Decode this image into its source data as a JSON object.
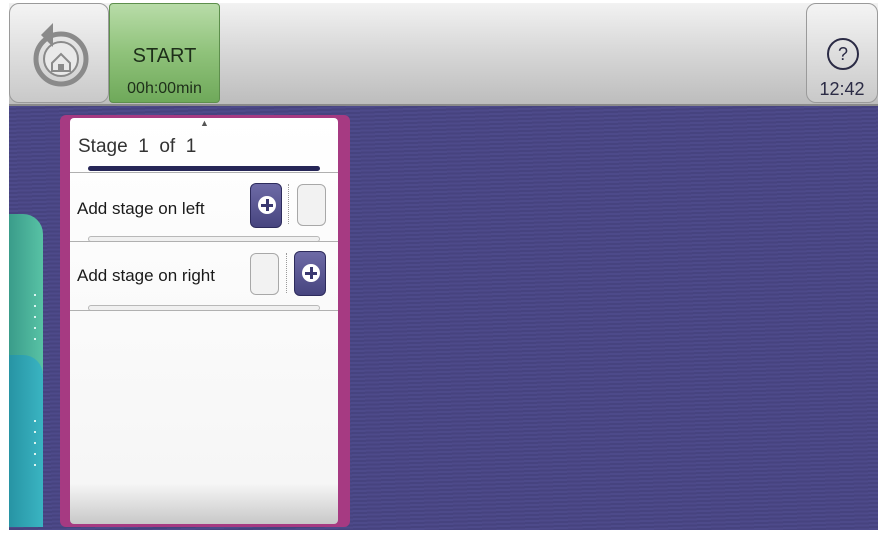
{
  "topbar": {
    "home_icon": "home-undo-icon",
    "start": {
      "label": "START",
      "time": "00h:00min"
    },
    "help": {
      "icon": "?",
      "clock": "12:42"
    }
  },
  "stage_panel": {
    "scroll_indicator": "▲",
    "stage_label": "Stage",
    "stage_current": "1",
    "stage_of": "of",
    "stage_total": "1",
    "rows": [
      {
        "label": "Add stage on left"
      },
      {
        "label": "Add stage on right"
      }
    ]
  },
  "colors": {
    "background": "#4d4a8a",
    "panel_border": "#a63a82",
    "start_green": "#8fc27a",
    "accent_navy": "#262657"
  }
}
